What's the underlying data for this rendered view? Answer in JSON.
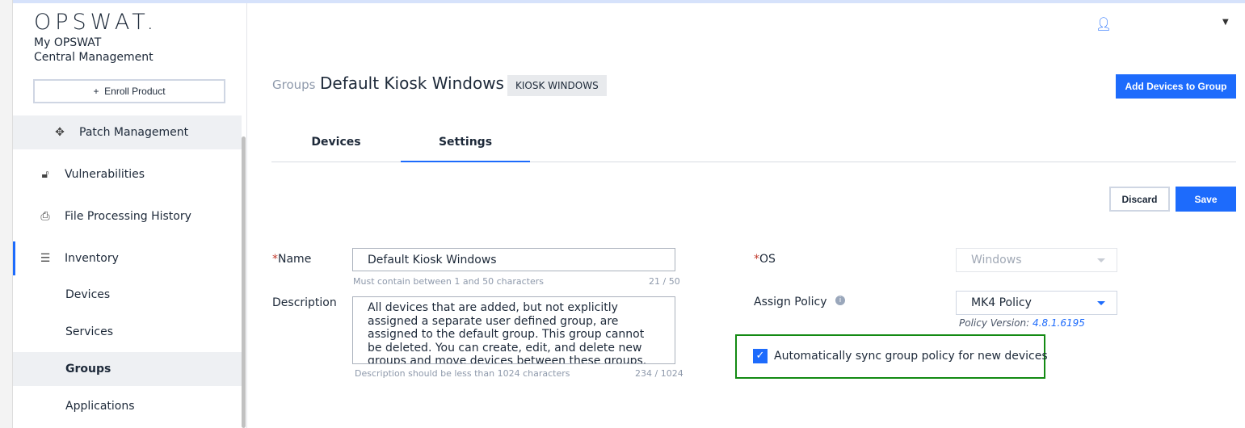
{
  "brand": {
    "logo": "OPSWAT.",
    "line1": "My OPSWAT",
    "line2": "Central Management"
  },
  "sidebar": {
    "enroll": "Enroll Product",
    "items": [
      {
        "label": "Patch Management",
        "icon": "puzzle-icon"
      },
      {
        "label": "Vulnerabilities",
        "icon": "lock-icon"
      },
      {
        "label": "File Processing History",
        "icon": "printer-icon"
      },
      {
        "label": "Inventory",
        "icon": "list-icon"
      }
    ],
    "subitems": [
      "Devices",
      "Services",
      "Groups",
      "Applications"
    ]
  },
  "header": {
    "crumb": "Groups",
    "title": "Default Kiosk Windows",
    "tag": "KIOSK WINDOWS",
    "add_button": "Add Devices to Group"
  },
  "tabs": [
    "Devices",
    "Settings"
  ],
  "actions": {
    "discard": "Discard",
    "save": "Save"
  },
  "form": {
    "name_label": "Name",
    "name_value": "Default Kiosk Windows",
    "name_hint": "Must contain between 1 and 50 characters",
    "name_count": "21 / 50",
    "desc_label": "Description",
    "desc_value": "All devices that are added, but not explicitly assigned a separate user defined group, are assigned to the default group. This group cannot be deleted. You can create, edit, and delete new groups and move devices between these groups.",
    "desc_hint": "Description should be less than 1024 characters",
    "desc_count": "234 / 1024",
    "os_label": "OS",
    "os_value": "Windows",
    "policy_label": "Assign Policy",
    "policy_value": "MK4 Policy",
    "policy_version_label": "Policy Version:",
    "policy_version": "4.8.1.6195",
    "sync_label": "Automatically sync group policy for new devices",
    "sync_checked": true
  },
  "colors": {
    "accent": "#1d6bfc",
    "highlight": "#138a13"
  }
}
